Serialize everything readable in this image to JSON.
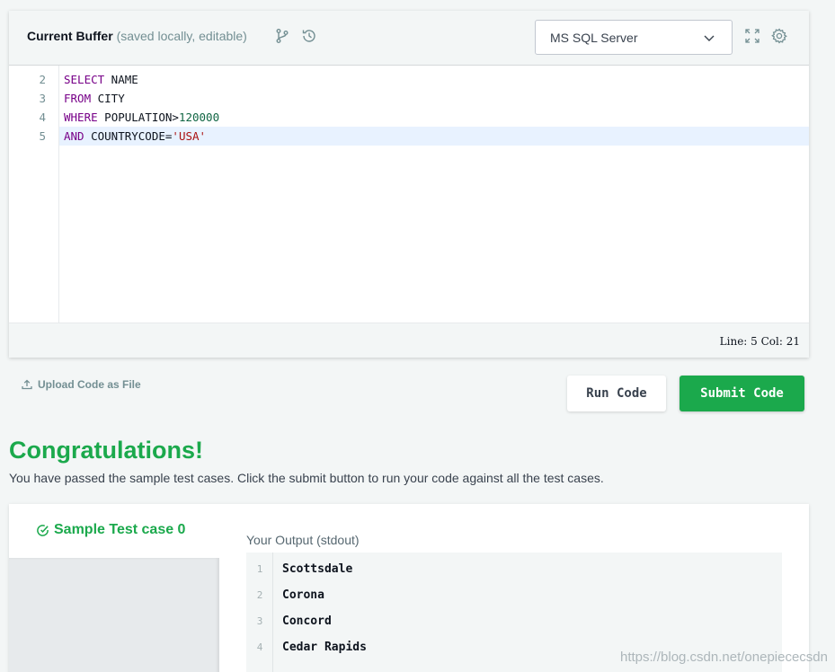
{
  "editor": {
    "title": "Current Buffer",
    "subtitle": "(saved locally, editable)",
    "language": "MS SQL Server",
    "lines": [
      {
        "num": "2",
        "tokens": [
          {
            "t": "SELECT",
            "c": "kw"
          },
          {
            "t": " NAME",
            "c": ""
          }
        ]
      },
      {
        "num": "3",
        "tokens": [
          {
            "t": "FROM",
            "c": "kw"
          },
          {
            "t": " CITY",
            "c": ""
          }
        ]
      },
      {
        "num": "4",
        "tokens": [
          {
            "t": "WHERE",
            "c": "kw"
          },
          {
            "t": " POPULATION>",
            "c": ""
          },
          {
            "t": "120000",
            "c": "num"
          }
        ]
      },
      {
        "num": "5",
        "tokens": [
          {
            "t": "AND",
            "c": "kw"
          },
          {
            "t": " COUNTRYCODE=",
            "c": ""
          },
          {
            "t": "'USA'",
            "c": "str"
          }
        ],
        "active": true
      }
    ],
    "status": "Line: 5 Col: 21"
  },
  "actions": {
    "upload_label": "Upload Code as File",
    "run_label": "Run Code",
    "submit_label": "Submit Code"
  },
  "result": {
    "heading": "Congratulations!",
    "message": "You have passed the sample test cases. Click the submit button to run your code against all the test cases."
  },
  "testcase": {
    "tab_label": "Sample Test case 0",
    "output_label": "Your Output (stdout)",
    "output_lines": [
      {
        "num": "1",
        "text": "Scottsdale"
      },
      {
        "num": "2",
        "text": "Corona"
      },
      {
        "num": "3",
        "text": "Concord"
      },
      {
        "num": "4",
        "text": "Cedar Rapids"
      }
    ]
  },
  "watermark": "https://blog.csdn.net/onepiececsdn",
  "colors": {
    "accent": "#1ba94c",
    "keyword": "#770088",
    "number": "#116644",
    "string": "#aa1111"
  }
}
